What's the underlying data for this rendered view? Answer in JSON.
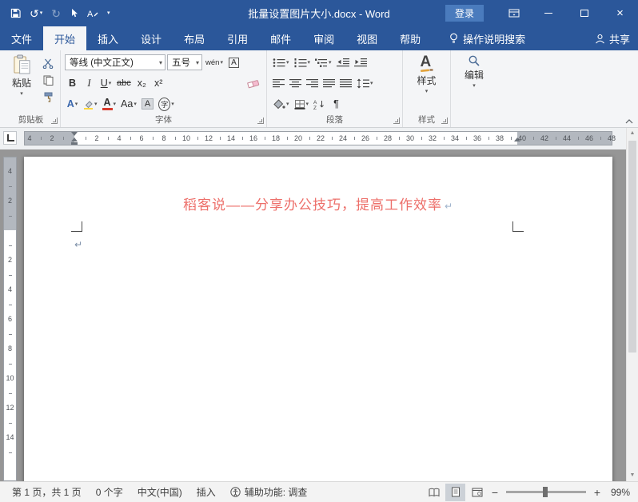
{
  "colors": {
    "accent": "#2b579a",
    "heading": "#ed6f6a",
    "highlight_yellow": "#ffd83d",
    "font_color_red": "#d83b2d"
  },
  "titlebar": {
    "title": "批量设置图片大小.docx - Word",
    "login": "登录"
  },
  "tabs": {
    "file": "文件",
    "active": "开始",
    "items": [
      "开始",
      "插入",
      "设计",
      "布局",
      "引用",
      "邮件",
      "审阅",
      "视图",
      "帮助"
    ],
    "tellme": "操作说明搜索",
    "share": "共享"
  },
  "ribbon": {
    "clipboard": {
      "group": "剪贴板",
      "paste": "粘贴"
    },
    "font": {
      "group": "字体",
      "name": "等线 (中文正文)",
      "size": "五号",
      "bold": "B",
      "italic": "I",
      "underline": "U",
      "strike": "abc",
      "subscript": "x₂",
      "superscript": "x²",
      "effects": "A",
      "color": "A",
      "case": "Aa",
      "shading": "A",
      "enclose": "字",
      "pinyin": "wén",
      "charborder": "A"
    },
    "paragraph": {
      "group": "段落",
      "pilcrow": "¶",
      "sort_a": "A",
      "sort_z": "Z"
    },
    "styles": {
      "group": "样式",
      "button": "样式",
      "icon_letter": "A"
    },
    "editing": {
      "button": "编辑"
    }
  },
  "ruler": {
    "h_margin": [
      "4",
      "2"
    ],
    "h_text": [
      "2",
      "4",
      "6",
      "8",
      "10",
      "12",
      "14",
      "16",
      "18",
      "20",
      "22",
      "24",
      "26",
      "28",
      "30",
      "32",
      "34",
      "36",
      "38"
    ],
    "h_right": [
      "40",
      "42",
      "44",
      "46",
      "48"
    ],
    "v_margin": [
      "4",
      "2"
    ],
    "v_text": [
      "2",
      "4",
      "6",
      "8",
      "10",
      "12",
      "14"
    ]
  },
  "document": {
    "heading": "稻客说——分享办公技巧，提高工作效率",
    "mark_after_heading": "↵",
    "mark_body": "↵"
  },
  "statusbar": {
    "page": "第 1 页，共 1 页",
    "words": "0 个字",
    "language": "中文(中国)",
    "mode": "插入",
    "accessibility": "辅助功能: 调查",
    "zoom": "99%",
    "zoom_minus": "−",
    "zoom_plus": "+"
  }
}
